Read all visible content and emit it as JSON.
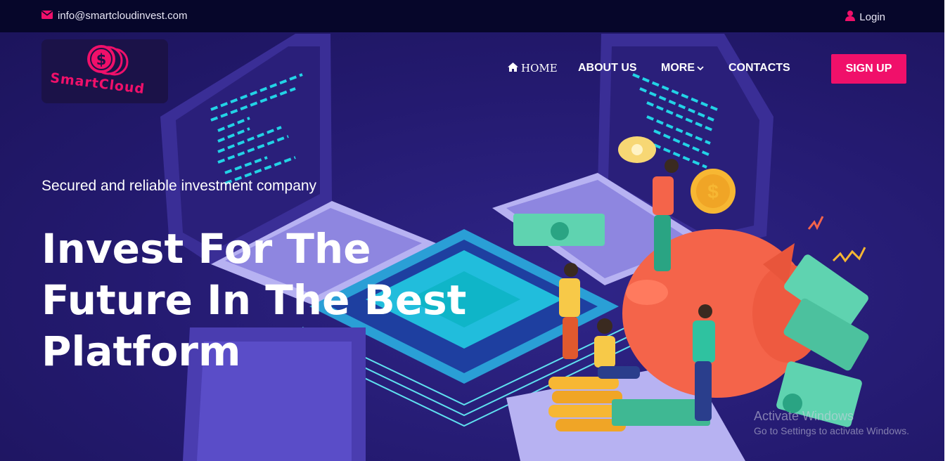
{
  "topbar": {
    "email": "info@smartcloudinvest.com",
    "login_label": "Login"
  },
  "logo": {
    "text": "SmartCloud"
  },
  "nav": {
    "home": "HOME",
    "about": "ABOUT US",
    "more": "MORE",
    "contacts": "CONTACTS",
    "signup": "SIGN UP"
  },
  "hero": {
    "tagline": "Secured and reliable investment company",
    "headline_line1": "Invest For The",
    "headline_line2": "Future In The Best",
    "headline_line3": "Platform"
  },
  "watermark": {
    "title": "Activate Windows",
    "subtitle": "Go to Settings to activate Windows."
  },
  "colors": {
    "accent": "#f0106a",
    "topbar_bg": "#06062a",
    "hero_bg": "#24196b"
  },
  "icons": [
    "envelope-icon",
    "user-icon",
    "home-icon",
    "chevron-down-icon",
    "dollar-coin-icon"
  ]
}
